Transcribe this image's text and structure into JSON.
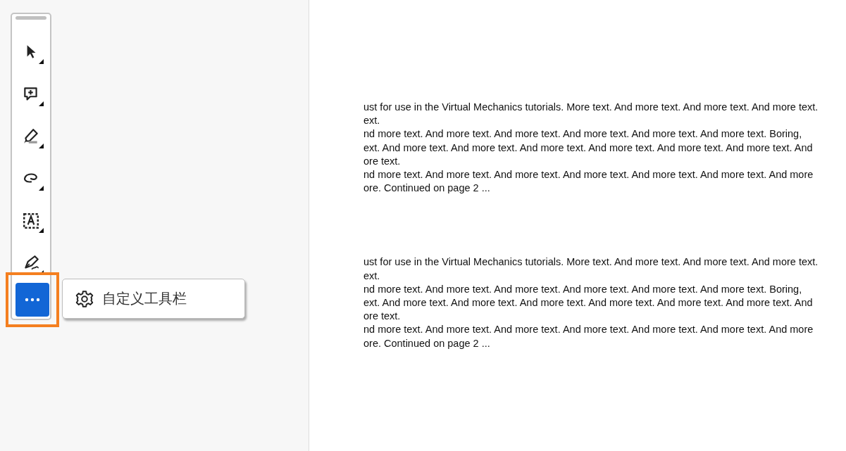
{
  "toolbar": {
    "tools": [
      {
        "kind": "select"
      },
      {
        "kind": "comment"
      },
      {
        "kind": "highlight"
      },
      {
        "kind": "draw"
      },
      {
        "kind": "text"
      },
      {
        "kind": "sign"
      }
    ],
    "more_button": {
      "highlighted": true
    }
  },
  "menu": {
    "items": [
      {
        "label": "自定义工具栏"
      }
    ]
  },
  "pages": [
    {
      "lines": [
        "ust for use in the Virtual Mechanics tutorials. More text. And more text. And more text. And more text.",
        "ext.",
        "nd more text. And more text. And more text. And more text. And more text. And more text. Boring,",
        "ext. And more text. And more text. And more text. And more text. And more text. And more text. And",
        "ore text.",
        "nd more text. And more text. And more text. And more text. And more text. And more text. And more",
        "ore. Continued on page 2 ..."
      ]
    },
    {
      "lines": [
        "ust for use in the Virtual Mechanics tutorials. More text. And more text. And more text. And more text.",
        "ext.",
        "nd more text. And more text. And more text. And more text. And more text. And more text. Boring,",
        "ext. And more text. And more text. And more text. And more text. And more text. And more text. And",
        "ore text.",
        "nd more text. And more text. And more text. And more text. And more text. And more text. And more",
        "ore. Continued on page 2 ..."
      ]
    }
  ]
}
